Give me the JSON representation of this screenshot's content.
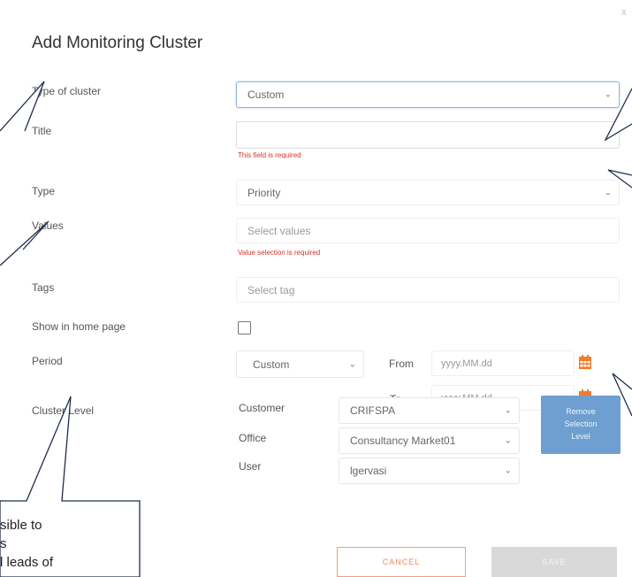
{
  "dialog": {
    "title": "Add Monitoring Cluster",
    "close_glyph": "x"
  },
  "form": {
    "type_of_cluster": {
      "label": "Type of cluster",
      "value": "Custom"
    },
    "title": {
      "label": "Title",
      "value": "",
      "error": "This field is required"
    },
    "type": {
      "label": "Type",
      "value": "Priority"
    },
    "values": {
      "label": "Values",
      "placeholder": "Select values",
      "error": "Value selection is required"
    },
    "tags": {
      "label": "Tags",
      "placeholder": "Select tag"
    },
    "show_in_home_page": {
      "label": "Show in home page",
      "checked": false
    },
    "period": {
      "label": "Period",
      "value": "Custom",
      "from_label": "From",
      "to_label": "To",
      "from_placeholder": "yyyy.MM.dd",
      "to_placeholder": "yyyy.MM.dd"
    },
    "cluster_level": {
      "label": "Cluster Level",
      "customer_label": "Customer",
      "customer_value": "CRIFSPA",
      "office_label": "Office",
      "office_value": "Consultancy Market01",
      "user_label": "User",
      "user_value": "lgervasi",
      "remove_button": [
        "Remove",
        "Selection",
        "Level"
      ]
    }
  },
  "buttons": {
    "cancel": "CANCEL",
    "save": "SAVE"
  },
  "annotation": {
    "line1": "sible to",
    "line2": "s",
    "line3": "l leads of"
  },
  "colors": {
    "accent": "#6e9fd0",
    "error": "#d9342b",
    "calendar": "#f07c2c",
    "cancel": "#f08a60"
  }
}
